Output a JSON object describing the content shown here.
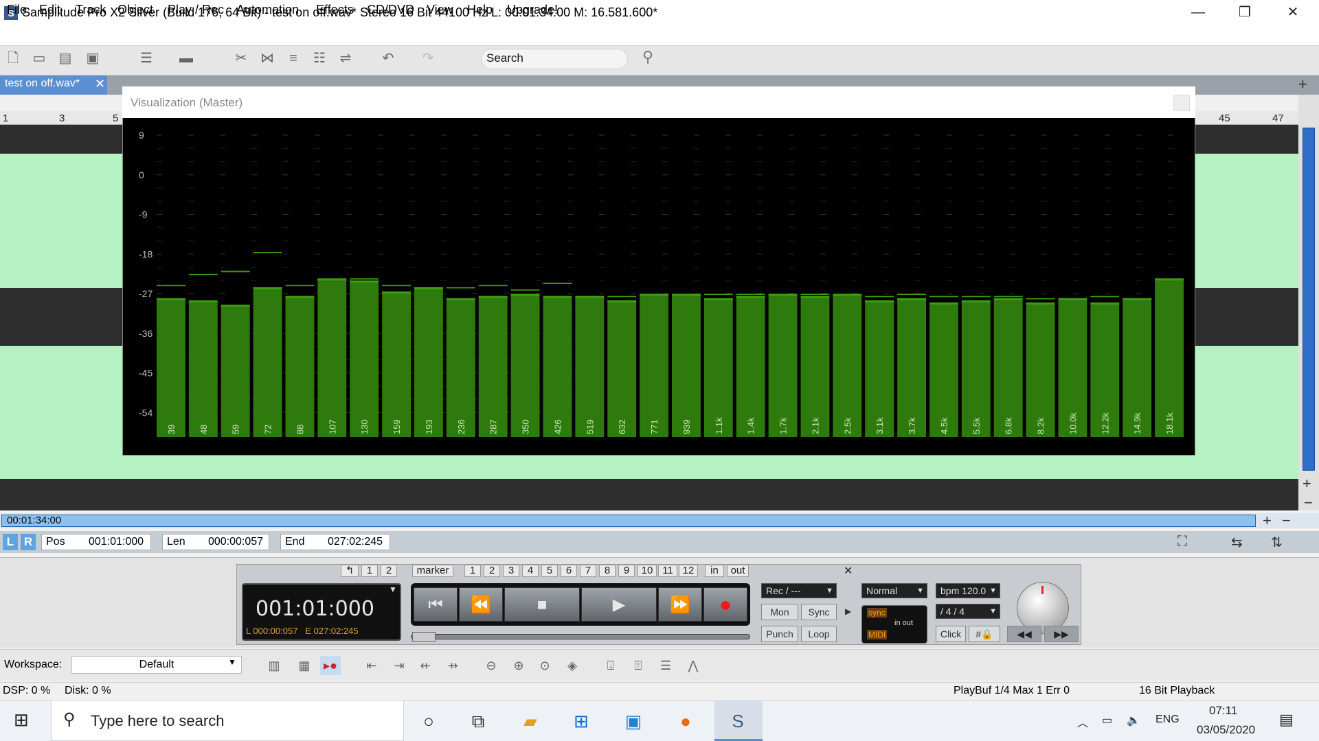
{
  "window": {
    "title": "Samplitude Pro X2 Silver (Build 176, 64 Bit)  -  test on off.wav*  Stereo 16 Bit 44100 Hz L: 00:01:34:00 M: 16.581.600*",
    "minimize": "—",
    "restore": "❐",
    "close": "✕"
  },
  "menu": [
    "File",
    "Edit",
    "Track",
    "Object",
    "Play / Rec",
    "Automation",
    "Effects",
    "CD/DVD",
    "View",
    "Help",
    "Upgrade!"
  ],
  "toolbar": {
    "search_placeholder": "Search"
  },
  "project_tab": {
    "label": "test on off.wav*",
    "close": "✕"
  },
  "ruler": {
    "marks": [
      "1",
      "3",
      "5",
      "45",
      "47"
    ]
  },
  "timeline": {
    "position": "00:01:34:00"
  },
  "posbar": {
    "l_btn": "L",
    "r_btn": "R",
    "pos_label": "Pos",
    "pos_value": "001:01:000",
    "len_label": "Len",
    "len_value": "000:00:057",
    "end_label": "End",
    "end_value": "027:02:245"
  },
  "transport": {
    "markers": [
      "↰",
      "1",
      "2",
      "marker",
      "1",
      "2",
      "3",
      "4",
      "5",
      "6",
      "7",
      "8",
      "9",
      "10",
      "11",
      "12",
      "in",
      "out"
    ],
    "time_main": "001:01:000",
    "time_sub_l": "L  000:00:057",
    "time_sub_e": "E  027:02:245",
    "rec_select": "Rec / ---",
    "mon": "Mon",
    "sync_btn": "Sync",
    "punch": "Punch",
    "loop": "Loop",
    "mode_select": "Normal",
    "bpm_select": "bpm  120.0",
    "sig_select": "/    4 / 4",
    "click": "Click",
    "sync_label": "sync",
    "midi_label": "MIDI",
    "inout_label": "in  out"
  },
  "workspace": {
    "label": "Workspace:",
    "value": "Default"
  },
  "status": {
    "dsp": "DSP: 0 %",
    "disk": "Disk:   0 %",
    "playbuf": "PlayBuf 1/4  Max 1  Err 0",
    "playback": "16 Bit Playback"
  },
  "taskbar": {
    "search_text": "Type here to search",
    "lang": "ENG",
    "time": "07:11",
    "date": "03/05/2020"
  },
  "viz": {
    "title": "Visualization (Master)"
  },
  "colors": {
    "bar": "#2e7a0c",
    "bar_highlight": "#3c9c14",
    "accent_blue": "#5c8fd2",
    "waveform_bg": "#b4f2c4"
  },
  "chart_data": {
    "type": "bar",
    "title": "",
    "ylim": [
      -63,
      9
    ],
    "yticks": [
      9,
      0,
      -9,
      -18,
      -27,
      -36,
      -45,
      -54
    ],
    "categories": [
      "39",
      "48",
      "59",
      "72",
      "88",
      "107",
      "130",
      "159",
      "193",
      "236",
      "287",
      "350",
      "426",
      "519",
      "632",
      "771",
      "939",
      "1.1k",
      "1.4k",
      "1.7k",
      "2.1k",
      "2.5k",
      "3.1k",
      "3.7k",
      "4.5k",
      "5.5k",
      "6.8k",
      "8.2k",
      "10.0k",
      "12.2k",
      "14.9k",
      "18.1k"
    ],
    "values": [
      -28,
      -28.5,
      -29.5,
      -25.5,
      -27.5,
      -23.5,
      -24,
      -26.5,
      -25.5,
      -28,
      -27.5,
      -27,
      -27.5,
      -27.5,
      -28.5,
      -27,
      -27,
      -28,
      -27.5,
      -27,
      -27.5,
      -27,
      -28.5,
      -28,
      -29,
      -28.5,
      -28,
      -29,
      -28,
      -29,
      -28,
      -23.5
    ],
    "peaks": [
      -25,
      -22.5,
      -21.8,
      -17.5,
      -25,
      -23.5,
      -23.5,
      -25,
      -25.5,
      -25.5,
      -25,
      -26,
      -24.5,
      -27.5,
      -27.5,
      -27,
      -27,
      -27,
      -27,
      -27,
      -27,
      -27,
      -27.5,
      -27,
      -27.5,
      -27.5,
      -27.5,
      -28,
      -28,
      -27.5,
      -28,
      -23.5
    ]
  }
}
